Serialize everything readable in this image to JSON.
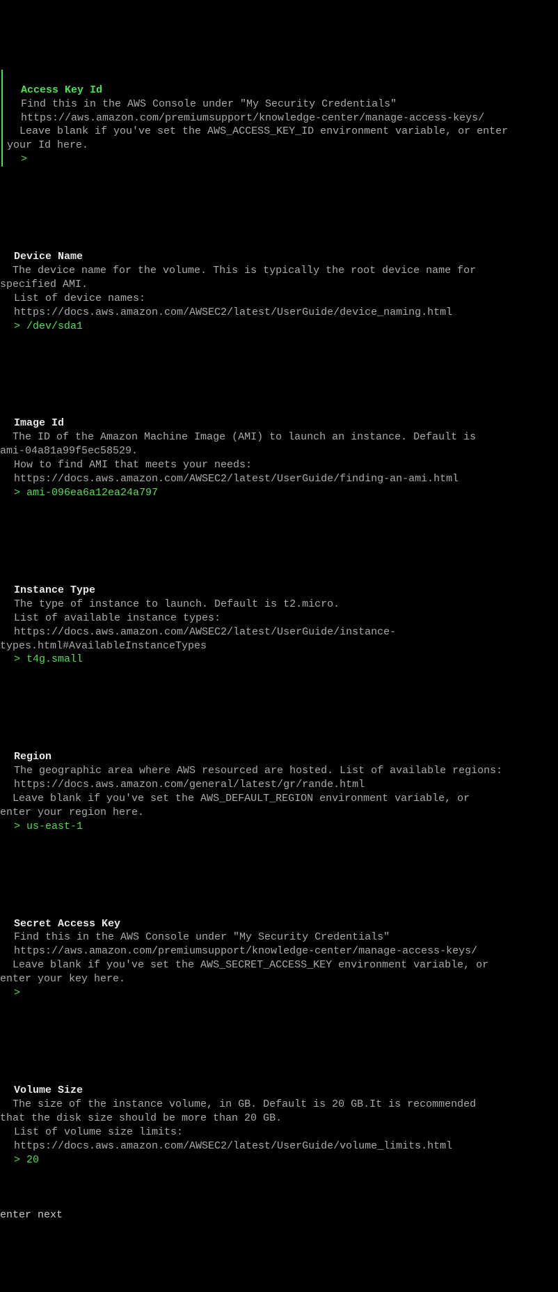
{
  "sections": {
    "accessKeyId": {
      "title": "Access Key Id",
      "desc1": "Find this in the AWS Console under \"My Security Credentials\"",
      "url": "https://aws.amazon.com/premiumsupport/knowledge-center/manage-access-keys/",
      "desc2_line1": "  Leave blank if you've set the AWS_ACCESS_KEY_ID environment variable, or enter",
      "desc2_line2": "your Id here.",
      "value": ""
    },
    "deviceName": {
      "title": "Device Name",
      "desc1_line1": "  The device name for the volume. This is typically the root device name for",
      "desc1_line2": "specified AMI.",
      "desc2": "List of device names:",
      "url": "https://docs.aws.amazon.com/AWSEC2/latest/UserGuide/device_naming.html",
      "value": "/dev/sda1"
    },
    "imageId": {
      "title": "Image Id",
      "desc1_line1": "  The ID of the Amazon Machine Image (AMI) to launch an instance. Default is",
      "desc1_line2": "ami-04a81a99f5ec58529.",
      "desc2": "How to find AMI that meets your needs:",
      "url": "https://docs.aws.amazon.com/AWSEC2/latest/UserGuide/finding-an-ami.html",
      "value": "ami-096ea6a12ea24a797"
    },
    "instanceType": {
      "title": "Instance Type",
      "desc1": "The type of instance to launch. Default is t2.micro.",
      "desc2": "List of available instance types:",
      "url_line1": "https://docs.aws.amazon.com/AWSEC2/latest/UserGuide/instance-",
      "url_line2": "types.html#AvailableInstanceTypes",
      "value": "t4g.small"
    },
    "region": {
      "title": "Region",
      "desc1": "The geographic area where AWS resourced are hosted. List of available regions:",
      "url": "https://docs.aws.amazon.com/general/latest/gr/rande.html",
      "desc2_line1": "  Leave blank if you've set the AWS_DEFAULT_REGION environment variable, or",
      "desc2_line2": "enter your region here.",
      "value": "us-east-1"
    },
    "secretAccessKey": {
      "title": "Secret Access Key",
      "desc1": "Find this in the AWS Console under \"My Security Credentials\"",
      "url": "https://aws.amazon.com/premiumsupport/knowledge-center/manage-access-keys/",
      "desc2_line1": "  Leave blank if you've set the AWS_SECRET_ACCESS_KEY environment variable, or",
      "desc2_line2": "enter your key here.",
      "value": ""
    },
    "volumeSize": {
      "title": "Volume Size",
      "desc1_line1": "  The size of the instance volume, in GB. Default is 20 GB.It is recommended",
      "desc1_line2": "that the disk size should be more than 20 GB.",
      "desc2": "List of volume size limits:",
      "url": "https://docs.aws.amazon.com/AWSEC2/latest/UserGuide/volume_limits.html",
      "value": "20"
    }
  },
  "prompt": ">",
  "footer": "enter next"
}
